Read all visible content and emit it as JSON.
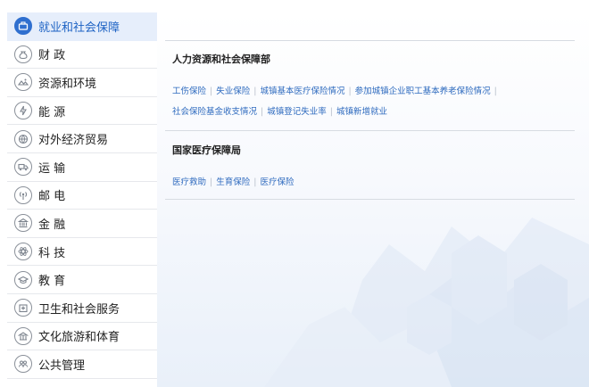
{
  "sidebar": {
    "items": [
      {
        "label": "就业和社会保障",
        "icon": "briefcase-icon",
        "active": true
      },
      {
        "label": "财 政",
        "icon": "money-bag-icon"
      },
      {
        "label": "资源和环境",
        "icon": "landscape-icon"
      },
      {
        "label": "能 源",
        "icon": "energy-icon"
      },
      {
        "label": "对外经济贸易",
        "icon": "globe-icon"
      },
      {
        "label": "运 输",
        "icon": "truck-icon"
      },
      {
        "label": "邮 电",
        "icon": "signal-tower-icon"
      },
      {
        "label": "金 融",
        "icon": "bank-icon"
      },
      {
        "label": "科 技",
        "icon": "atom-icon"
      },
      {
        "label": "教 育",
        "icon": "graduation-cap-icon"
      },
      {
        "label": "卫生和社会服务",
        "icon": "medical-building-icon"
      },
      {
        "label": "文化旅游和体育",
        "icon": "culture-icon"
      },
      {
        "label": "公共管理",
        "icon": "people-icon"
      }
    ]
  },
  "main": {
    "departments": [
      {
        "title": "人力资源和社会保障部",
        "links": [
          "工伤保险",
          "失业保险",
          "城镇基本医疗保险情况",
          "参加城镇企业职工基本养老保险情况",
          "社会保险基金收支情况",
          "城镇登记失业率",
          "城镇新增就业"
        ]
      },
      {
        "title": "国家医疗保障局",
        "links": [
          "医疗救助",
          "生育保险",
          "医疗保险"
        ]
      }
    ]
  },
  "colors": {
    "accent": "#2f6fcf",
    "link": "#2f6bbf",
    "active_bg": "#e6eefb"
  }
}
